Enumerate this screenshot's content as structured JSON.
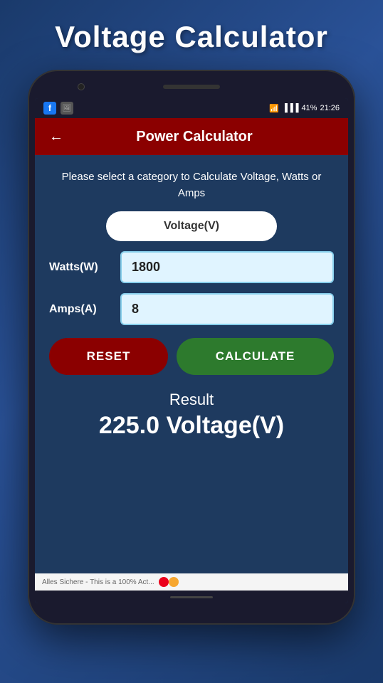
{
  "page": {
    "title": "Voltage Calculator",
    "background_gradient_start": "#1a3a6b",
    "background_gradient_end": "#2a5298"
  },
  "status_bar": {
    "battery": "41%",
    "time": "21:26",
    "wifi": "WiFi",
    "signal": "Signal"
  },
  "app_bar": {
    "title": "Power Calculator",
    "back_icon": "←"
  },
  "content": {
    "instruction": "Please select a category to Calculate Voltage, Watts or Amps",
    "category_label": "Voltage(V)",
    "watts_label": "Watts(W)",
    "watts_value": "1800",
    "amps_label": "Amps(A)",
    "amps_value": "8",
    "reset_label": "RESET",
    "calculate_label": "CALCULATE",
    "result_label": "Result",
    "result_value": "225.0 Voltage(V)"
  },
  "ad": {
    "text": "Alles Sichere - This is a 100% Act..."
  }
}
